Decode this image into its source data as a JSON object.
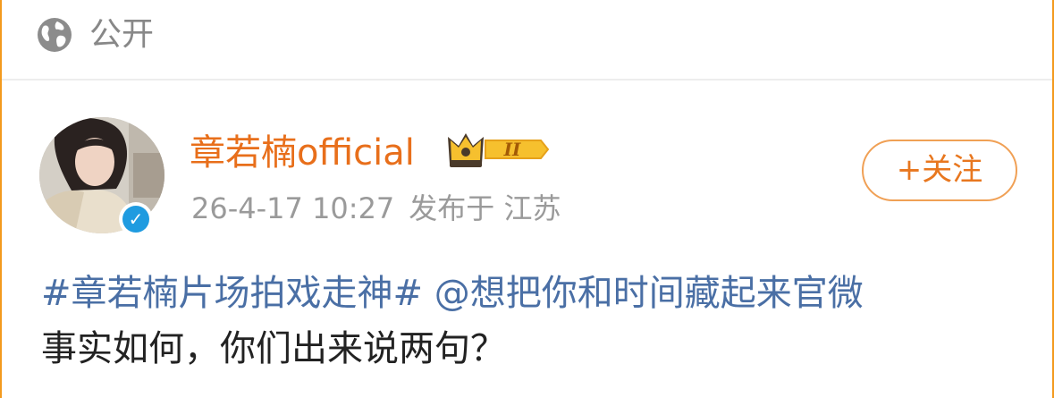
{
  "visibility": {
    "icon": "globe-icon",
    "label": "公开"
  },
  "author": {
    "name": "章若楠official",
    "level_badge": "II",
    "verified_icon": "verified-icon",
    "crown_icon": "crown-icon"
  },
  "meta": {
    "time": "26-4-17 10:27",
    "location": "发布于 江苏"
  },
  "follow_button": {
    "label": "+关注"
  },
  "post": {
    "topic": "#章若楠片场拍戏走神#",
    "mention": "@想把你和时间藏起来官微",
    "text": "事实如何，你们出来说两句？"
  },
  "colors": {
    "accent": "#e86f1b",
    "link": "#4a6fa5",
    "verified": "#1f9be0",
    "border": "#f39a1e"
  }
}
